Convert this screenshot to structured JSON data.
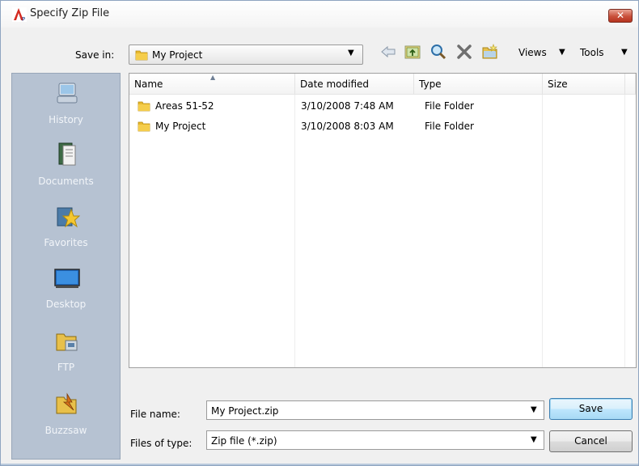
{
  "window": {
    "title": "Specify Zip File",
    "close_glyph": "✕"
  },
  "toolbar": {
    "save_in_label": "Save in:",
    "save_in_value": "My Project",
    "icons": [
      "back-arrow-icon",
      "up-folder-icon",
      "search-web-icon",
      "delete-icon",
      "create-folder-icon"
    ],
    "views_label": "Views",
    "tools_label": "Tools"
  },
  "places": [
    {
      "label": "History",
      "icon": "history-icon"
    },
    {
      "label": "Documents",
      "icon": "documents-icon"
    },
    {
      "label": "Favorites",
      "icon": "favorites-icon"
    },
    {
      "label": "Desktop",
      "icon": "desktop-icon"
    },
    {
      "label": "FTP",
      "icon": "ftp-icon"
    },
    {
      "label": "Buzzsaw",
      "icon": "buzzsaw-icon"
    }
  ],
  "filelist": {
    "columns": [
      "Name",
      "Date modified",
      "Type",
      "Size"
    ],
    "rows": [
      {
        "name": "Areas 51-52",
        "date": "3/10/2008 7:48 AM",
        "type": "File Folder",
        "size": ""
      },
      {
        "name": "My Project",
        "date": "3/10/2008 8:03 AM",
        "type": "File Folder",
        "size": ""
      }
    ]
  },
  "form": {
    "file_name_label": "File name:",
    "file_name_value": "My Project.zip",
    "file_type_label": "Files of type:",
    "file_type_value": "Zip file (*.zip)"
  },
  "buttons": {
    "save": "Save",
    "cancel": "Cancel"
  },
  "colors": {
    "places_bg": "#b6c2d2",
    "close_red": "#c9503b",
    "folder_yellow": "#e8b92e"
  }
}
